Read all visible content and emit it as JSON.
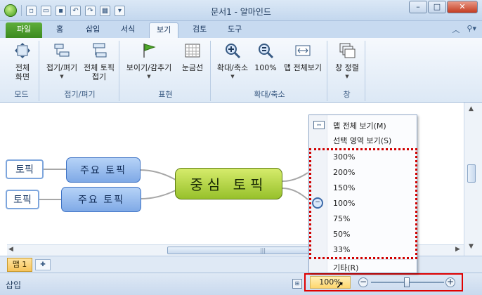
{
  "window": {
    "title": "문서1 - 알마인드"
  },
  "tabs": {
    "file": "파일",
    "home": "홈",
    "insert": "삽입",
    "format": "서식",
    "view": "보기",
    "review": "검토",
    "tools": "도구"
  },
  "ribbon": {
    "mode_group": {
      "label": "모드",
      "full_screen": "전체\n화면"
    },
    "fold_group": {
      "label": "접기/펴기",
      "fold": "접기/펴기",
      "fold_all": "전체 토픽\n접기"
    },
    "display_group": {
      "label": "표현",
      "show_hide": "보이기/감추기",
      "gridlines": "눈금선"
    },
    "zoom_group": {
      "label": "확대/축소",
      "zoom": "확대/축소",
      "percent": "100%",
      "fit_map": "맵 전체보기"
    },
    "window_group": {
      "label": "창",
      "arrange": "창 정렬"
    }
  },
  "mindmap": {
    "center": "중심 토픽",
    "main1": "주요 토픽",
    "main2": "주요 토픽",
    "sub1": "토픽",
    "sub2": "토픽"
  },
  "menu": {
    "fit_map": "맵 전체 보기(M)",
    "fit_selection": "선택 영역 보기(S)",
    "zoom_levels": [
      "300%",
      "200%",
      "150%",
      "100%",
      "75%",
      "50%",
      "33%"
    ],
    "other": "기타(R)"
  },
  "sheet_tab": "맵 1",
  "statusbar": {
    "text": "삽입",
    "zoom": "100%"
  },
  "colors": {
    "accent_red": "#e00000",
    "file_tab": "#4a9a2a",
    "center_topic": "#b5d845"
  }
}
